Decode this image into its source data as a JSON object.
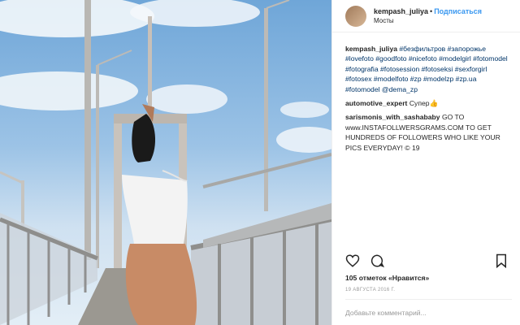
{
  "post": {
    "username": "kempash_juliya",
    "separator": "•",
    "follow_label": "Подписаться",
    "location": "Мосты"
  },
  "caption": {
    "username": "kempash_juliya",
    "text": "#безфильтров #запорожье #lovefoto #goodfoto #nicefoto #modelgirl #fotomodel #fotografia #fotosession #fotoseksi #sexforgirl #fotosex #modelfoto #zp #modelzp #zp.ua #fotomodel @dema_zp"
  },
  "comments": [
    {
      "username": "automotive_expert",
      "text": "Супер👍"
    },
    {
      "username": "sarismonis_with_sashababy",
      "text": "GO TO www.INSTAFOLLWERSGRAMS.COM TO GET HUNDREDS OF FOLLOWERS WHO LIKE YOUR PICS EVERYDAY! © 19"
    }
  ],
  "likes": "105 отметок «Нравится»",
  "date": "19 АВГУСТА 2016 Г.",
  "add_comment_placeholder": "Добавьте комментарий...",
  "icons": {
    "avatar": "avatar",
    "like": "heart-icon",
    "comment": "comment-icon",
    "bookmark": "bookmark-icon"
  },
  "colors": {
    "follow": "#3897f0",
    "hashtag": "#003569",
    "muted": "#999999"
  }
}
